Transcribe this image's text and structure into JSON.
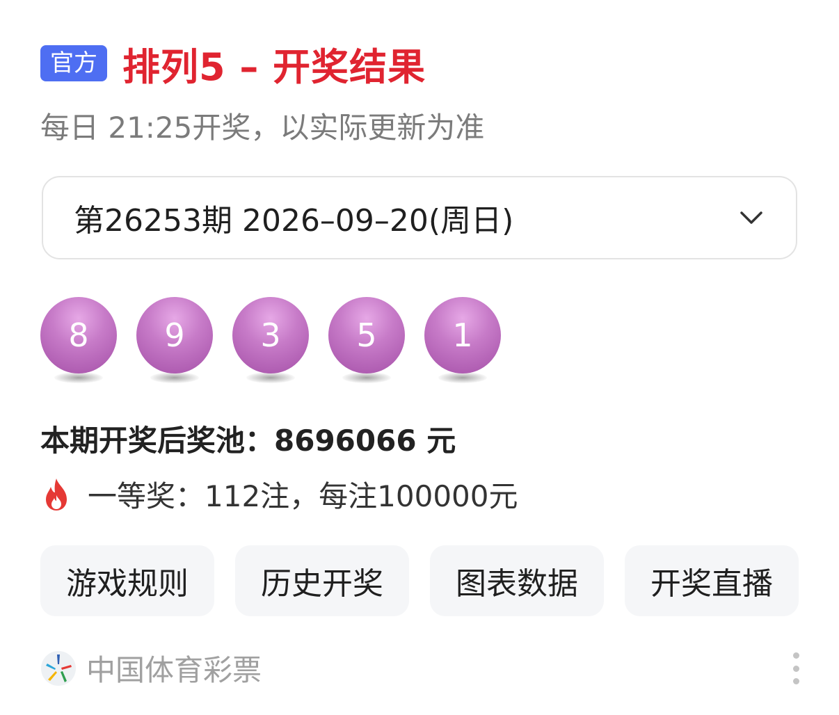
{
  "header": {
    "badge": "官方",
    "title": "排列5 – 开奖结果",
    "title_color": "#e02430",
    "badge_color": "#4e6ef2"
  },
  "subtitle": "每日 21:25开奖，以实际更新为准",
  "selector": {
    "value": "第26253期 2026–09–20(周日)",
    "icon": "chevron-down-icon"
  },
  "balls": [
    "8",
    "9",
    "3",
    "5",
    "1"
  ],
  "ball_color": "#c77bc8",
  "pool_text": "本期开奖后奖池：8696066 元",
  "prize": {
    "icon": "fire-icon",
    "text": "一等奖：112注，每注100000元"
  },
  "actions": [
    {
      "label": "游戏规则"
    },
    {
      "label": "历史开奖"
    },
    {
      "label": "图表数据"
    },
    {
      "label": "开奖直播"
    }
  ],
  "footer": {
    "source": "中国体育彩票",
    "logo_icon": "lottery-logo-icon",
    "more_icon": "more-vertical-icon"
  }
}
